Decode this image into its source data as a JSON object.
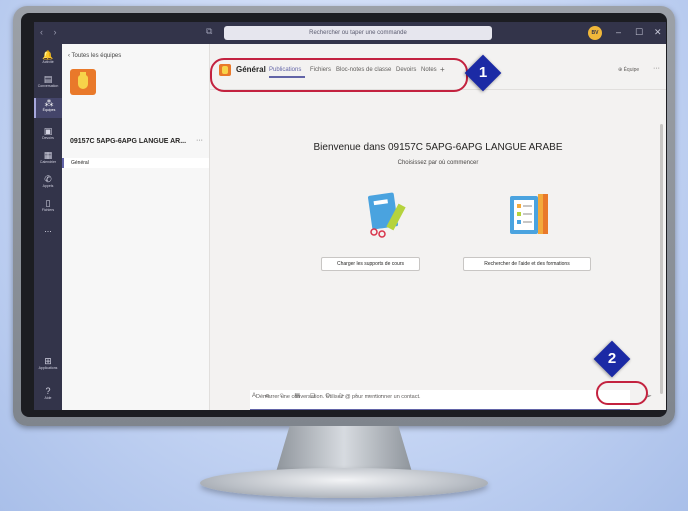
{
  "titlebar": {
    "search_placeholder": "Rechercher ou taper une commande",
    "avatar_initials": "BV",
    "minimize": "–",
    "maximize": "☐",
    "close": "✕",
    "nav": "‹ ›"
  },
  "rail": {
    "items": [
      {
        "label": "Activité",
        "icon": "bell-icon",
        "glyph": "🔔"
      },
      {
        "label": "Conversation",
        "icon": "chat-icon",
        "glyph": "▤"
      },
      {
        "label": "Équipes",
        "icon": "teams-icon",
        "glyph": "⁂"
      },
      {
        "label": "Devoirs",
        "icon": "assignments-icon",
        "glyph": "▣"
      },
      {
        "label": "Calendrier",
        "icon": "calendar-icon",
        "glyph": "▦"
      },
      {
        "label": "Appels",
        "icon": "phone-icon",
        "glyph": "✆"
      },
      {
        "label": "Fichiers",
        "icon": "files-icon",
        "glyph": "▯"
      },
      {
        "label": "...",
        "icon": "more-icon",
        "glyph": "…"
      }
    ],
    "apps_label": "Applications",
    "help_label": "Aide"
  },
  "team_pane": {
    "back_label": "‹  Toutes les équipes",
    "team_name": "09157C 5APG-6APG LANGUE AR...",
    "more": "···",
    "channel": "Général"
  },
  "channel_header": {
    "title": "Général",
    "tabs": [
      "Publications",
      "Fichiers",
      "Bloc-notes de classe",
      "Devoirs",
      "Notes"
    ],
    "add": "+",
    "team_button": "⊕ Équipe",
    "more": "···"
  },
  "welcome": {
    "title": "Bienvenue dans 09157C 5APG-6APG LANGUE ARABE",
    "subtitle": "Choisissez par où commencer",
    "upload_button": "Charger les supports de cours",
    "help_button": "Rechercher de l'aide et des formations"
  },
  "composer": {
    "placeholder": "Démarrer une conversation. Utilisez @ pour mentionner un contact.",
    "tools": "A  ⌀  ☺  ▤  ▢  ⊙  ▷  ♀  ···",
    "send": "➢"
  },
  "annotations": {
    "badge_1": "1",
    "badge_2": "2",
    "accent_color": "#c3223f",
    "badge_color": "#1b2aa5"
  }
}
